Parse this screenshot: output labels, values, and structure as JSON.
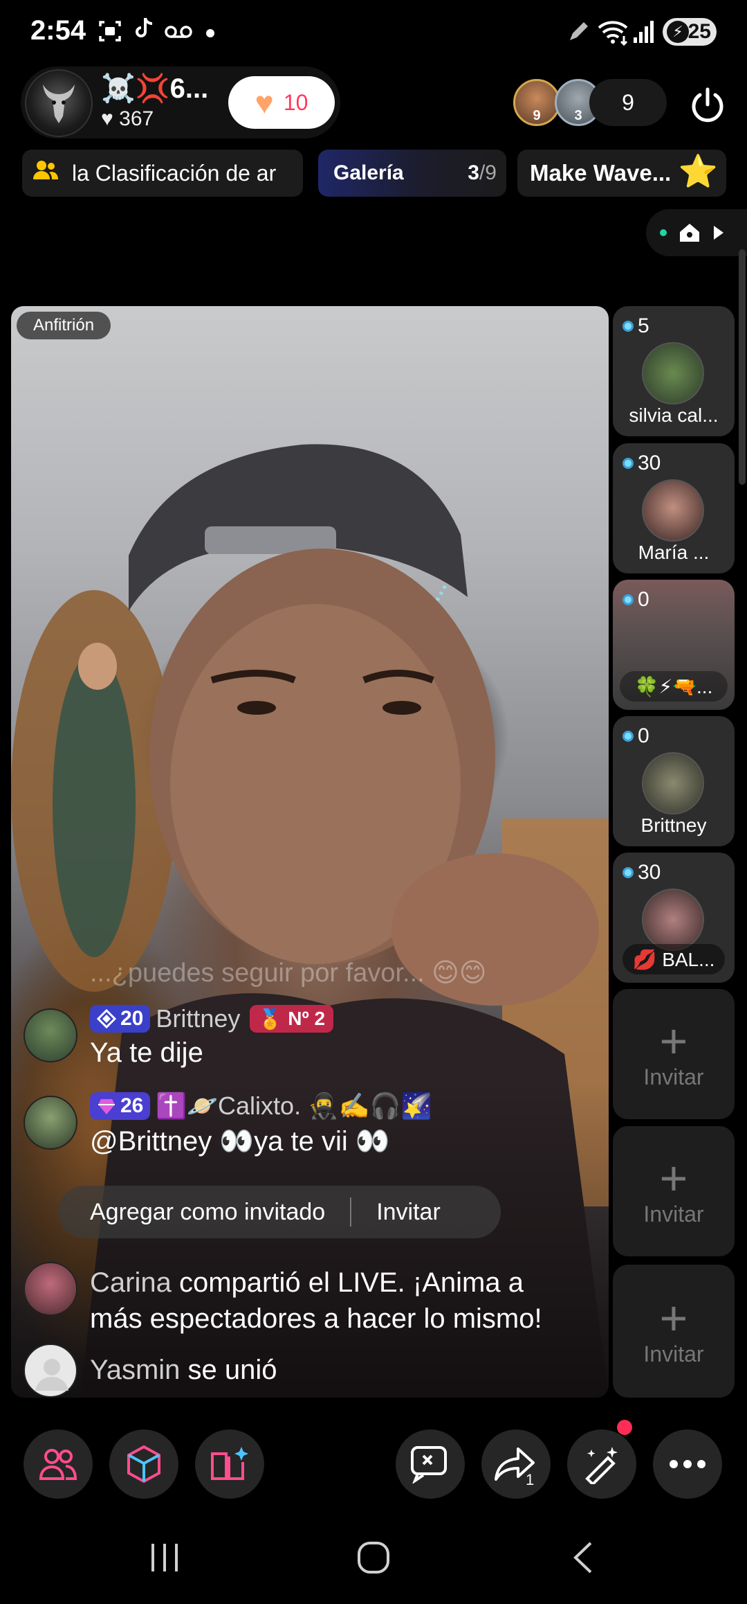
{
  "status_bar": {
    "time": "2:54",
    "battery": "25"
  },
  "host": {
    "name": "☠️💢6...",
    "likes": "♥ 367",
    "follow_count": "10",
    "avatar_icon": "goat-skull-icon"
  },
  "viewers": {
    "avatar_1_badge": "9",
    "avatar_2_badge": "3",
    "count": "9"
  },
  "chips": {
    "ranking": "la Clasificación de ar",
    "gallery_label": "Galería",
    "gallery_page": "3",
    "gallery_total": "/9",
    "wave": "Make Wave..."
  },
  "video": {
    "host_label": "Anfitrión"
  },
  "comments": {
    "faded": "...¿puedes seguir por favor... 😊😊",
    "items": [
      {
        "level": "20",
        "name": "Brittney",
        "rank": "Nº 2",
        "message": "Ya te dije"
      },
      {
        "level": "26",
        "name": "✝️🪐Calixto. 🥷✍️🎧🌠",
        "message": "@Brittney 👀ya te vii 👀"
      }
    ],
    "invite_bar": {
      "add_guest": "Agregar como invitado",
      "invite": "Invitar"
    },
    "share": {
      "name": "Carina",
      "text_1": " compartió el LIVE. ¡Anima a",
      "text_2": "más espectadores a hacer lo mismo!"
    },
    "join": {
      "name": "Yasmin",
      "text": " se unió"
    }
  },
  "guests": [
    {
      "score": "5",
      "name": "silvia cal..."
    },
    {
      "score": "30",
      "name": "María ..."
    },
    {
      "score": "0",
      "name": "🍀⚡🔫..."
    },
    {
      "score": "0",
      "name": "Brittney"
    },
    {
      "score": "30",
      "name": "💋 BAL..."
    }
  ],
  "invite_slots": [
    "Invitar",
    "Invitar",
    "Invitar"
  ],
  "toolbar": {
    "share_count": "1"
  },
  "colors": {
    "accent_pink": "#ff3b5c",
    "level_badge": "#3a40c9",
    "rank_badge": "#c0284a",
    "chip_bg": "#1c1c1c"
  }
}
